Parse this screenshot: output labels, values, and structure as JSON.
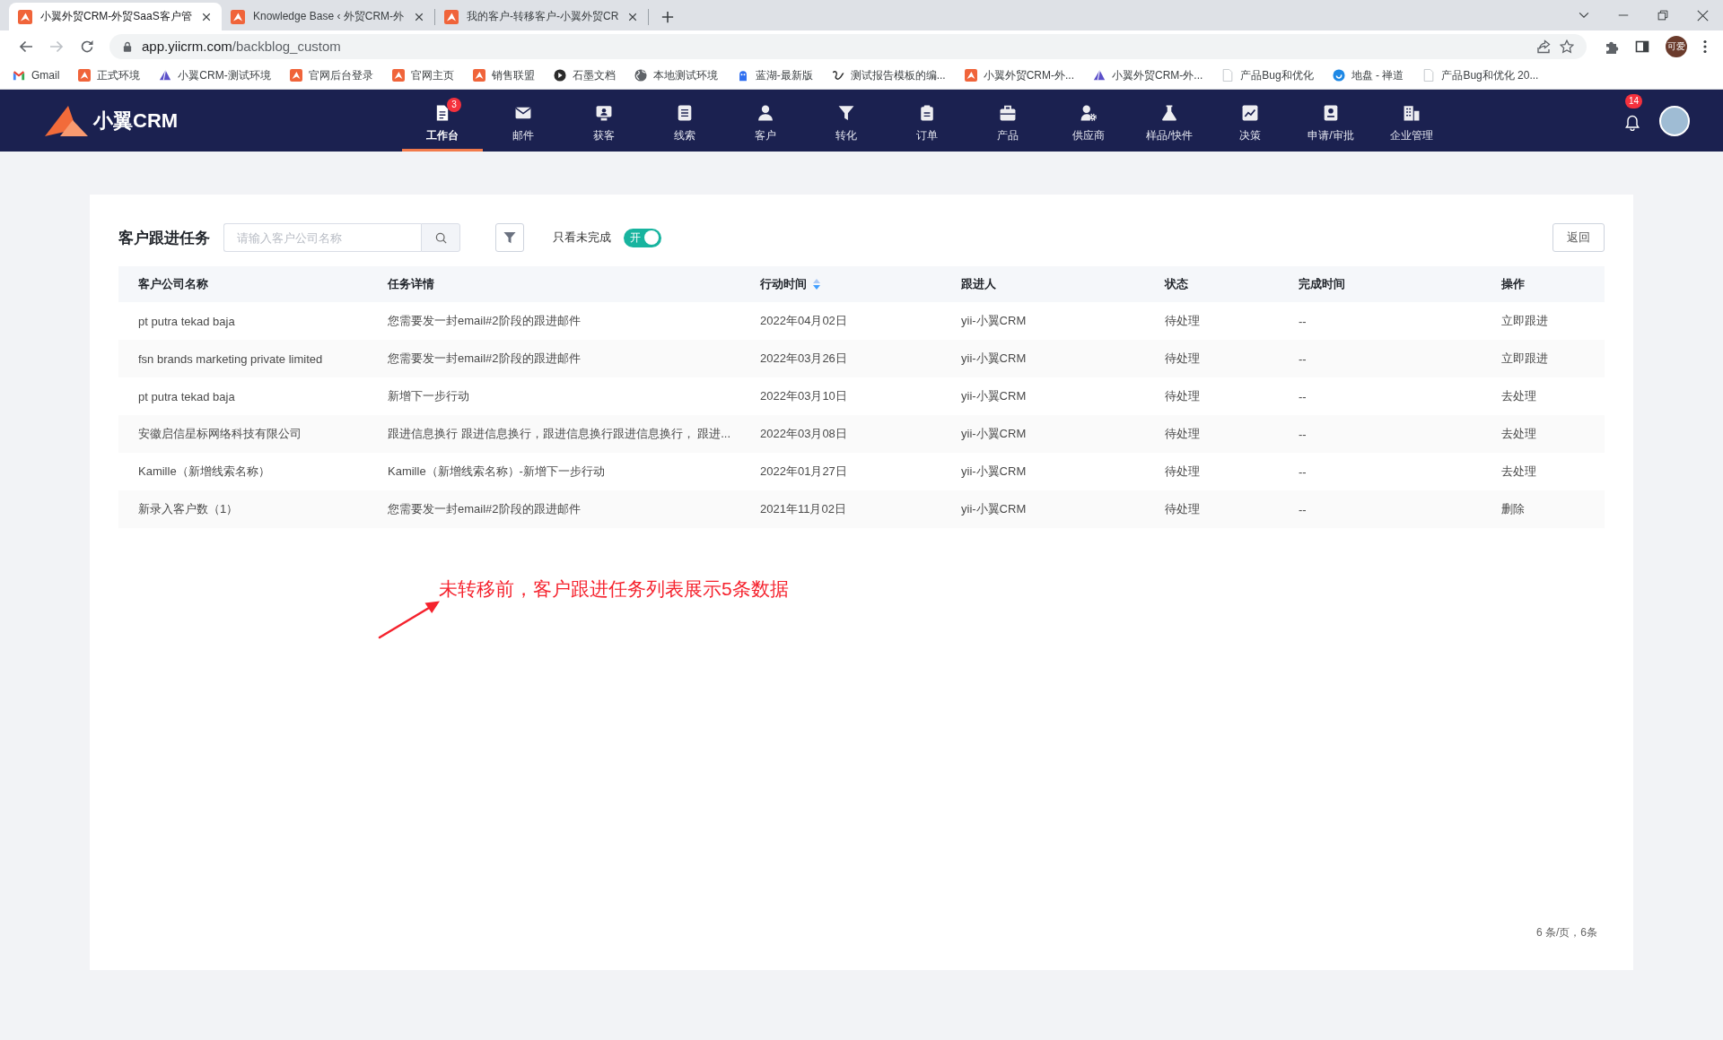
{
  "browser": {
    "tabs": [
      {
        "title": "小翼外贸CRM-外贸SaaS客户管",
        "selected": true
      },
      {
        "title": "Knowledge Base ‹ 外贸CRM-外",
        "selected": false
      },
      {
        "title": "我的客户-转移客户-小翼外贸CR",
        "selected": false
      }
    ],
    "nav_buttons": [
      {
        "kind": "back",
        "disabled": false
      },
      {
        "kind": "forward",
        "disabled": true
      },
      {
        "kind": "reload",
        "disabled": false
      }
    ],
    "address": {
      "host": "app.yiicrm.com",
      "path": "/backblog_custom"
    },
    "profile": "可爱",
    "bookmarks": [
      {
        "label": "Gmail",
        "kind": "mail"
      },
      {
        "label": "正式环境",
        "kind": "brand"
      },
      {
        "label": "小翼CRM-测试环境",
        "kind": "peak"
      },
      {
        "label": "官网后台登录",
        "kind": "brand"
      },
      {
        "label": "官网主页",
        "kind": "brand"
      },
      {
        "label": "销售联盟",
        "kind": "brand"
      },
      {
        "label": "石墨文档",
        "kind": "circle"
      },
      {
        "label": "本地测试环境",
        "kind": "globe"
      },
      {
        "label": "蓝湖-最新版",
        "kind": "bot"
      },
      {
        "label": "测试报告模板的编...",
        "kind": "script"
      },
      {
        "label": "小翼外贸CRM-外...",
        "kind": "brand"
      },
      {
        "label": "小翼外贸CRM-外...",
        "kind": "peak"
      },
      {
        "label": "产品Bug和优化",
        "kind": "page"
      },
      {
        "label": "地盘 - 禅道",
        "kind": "swirl"
      },
      {
        "label": "产品Bug和优化 20...",
        "kind": "page"
      }
    ]
  },
  "header": {
    "logo": "小翼CRM",
    "nav": [
      {
        "label": "工作台",
        "kind": "desk",
        "selected": true,
        "badge": "3"
      },
      {
        "label": "邮件",
        "kind": "mail",
        "selected": false
      },
      {
        "label": "获客",
        "kind": "acquire",
        "selected": false
      },
      {
        "label": "线索",
        "kind": "leads",
        "selected": false
      },
      {
        "label": "客户",
        "kind": "person",
        "selected": false
      },
      {
        "label": "转化",
        "kind": "funnel",
        "selected": false
      },
      {
        "label": "订单",
        "kind": "clipboard",
        "selected": false
      },
      {
        "label": "产品",
        "kind": "bag",
        "selected": false
      },
      {
        "label": "供应商",
        "kind": "supplier",
        "selected": false
      },
      {
        "label": "样品/快件",
        "kind": "flask",
        "selected": false
      },
      {
        "label": "决策",
        "kind": "chart",
        "selected": false
      },
      {
        "label": "申请/审批",
        "kind": "approval",
        "selected": false
      },
      {
        "label": "企业管理",
        "kind": "building",
        "selected": false
      }
    ],
    "notifications": "14"
  },
  "panel": {
    "title": "客户跟进任务",
    "search": {
      "placeholder": "请输入客户公司名称"
    },
    "only_incomplete": {
      "label": "只看未完成",
      "on": true,
      "state_text": "开"
    },
    "back_button": "返回",
    "table": {
      "columns": [
        {
          "label": "客户公司名称",
          "sortable": false
        },
        {
          "label": "任务详情",
          "sortable": false
        },
        {
          "label": "行动时间",
          "sortable": true
        },
        {
          "label": "跟进人",
          "sortable": false
        },
        {
          "label": "状态",
          "sortable": false
        },
        {
          "label": "完成时间",
          "sortable": false
        },
        {
          "label": "操作",
          "sortable": false
        }
      ],
      "rows": [
        {
          "cells": [
            "pt putra tekad baja",
            "您需要发一封email#2阶段的跟进邮件",
            "2022年04月02日",
            "yii-小翼CRM",
            "待处理",
            "--"
          ],
          "action": "立即跟进"
        },
        {
          "cells": [
            "fsn brands marketing private limited",
            "您需要发一封email#2阶段的跟进邮件",
            "2022年03月26日",
            "yii-小翼CRM",
            "待处理",
            "--"
          ],
          "action": "立即跟进"
        },
        {
          "cells": [
            "pt putra tekad baja",
            "新增下一步行动",
            "2022年03月10日",
            "yii-小翼CRM",
            "待处理",
            "--"
          ],
          "action": "去处理"
        },
        {
          "cells": [
            "安徽启信星标网络科技有限公司",
            "跟进信息换行 跟进信息换行，跟进信息换行跟进信息换行， 跟进...",
            "2022年03月08日",
            "yii-小翼CRM",
            "待处理",
            "--"
          ],
          "action": "去处理"
        },
        {
          "cells": [
            "Kamille（新增线索名称）",
            "Kamille（新增线索名称）-新增下一步行动",
            "2022年01月27日",
            "yii-小翼CRM",
            "待处理",
            "--"
          ],
          "action": "去处理"
        },
        {
          "cells": [
            "新录入客户数（1）",
            "您需要发一封email#2阶段的跟进邮件",
            "2021年11月02日",
            "yii-小翼CRM",
            "待处理",
            "--"
          ],
          "action": "删除"
        }
      ]
    },
    "pagination": "6 条/页，6条"
  },
  "annotation": {
    "text": "未转移前，客户跟进任务列表展示5条数据"
  }
}
